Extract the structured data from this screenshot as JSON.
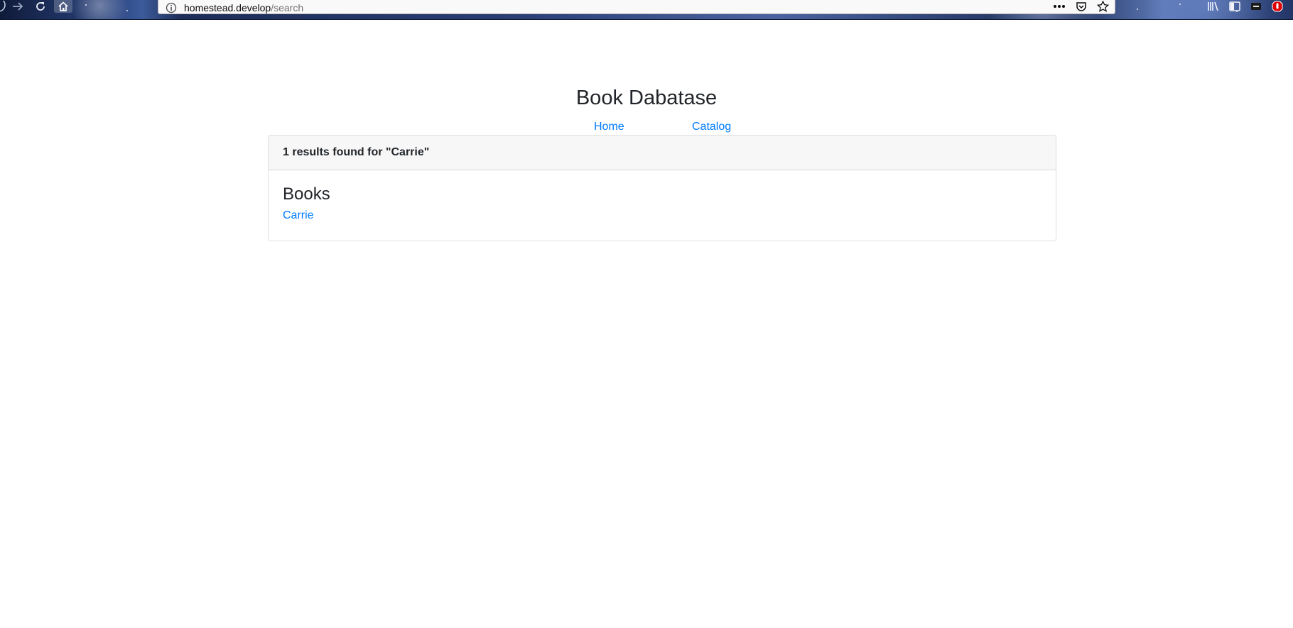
{
  "browser": {
    "url_host": "homestead.develop",
    "url_path": "/search",
    "icons": [
      "forward-icon",
      "reload-icon",
      "home-icon",
      "info-icon",
      "page-actions-icon",
      "pocket-icon",
      "bookmark-star-icon",
      "library-icon",
      "sidebar-icon",
      "extension-icon",
      "adblock-icon"
    ]
  },
  "page": {
    "title": "Book Dabatase",
    "nav": {
      "home": "Home",
      "catalog": "Catalog"
    },
    "results": {
      "header": "1 results found for \"Carrie\"",
      "section_title": "Books",
      "items": [
        "Carrie"
      ]
    }
  },
  "colors": {
    "link": "#007bff",
    "text": "#212529",
    "card_header_bg": "#f7f7f7"
  }
}
